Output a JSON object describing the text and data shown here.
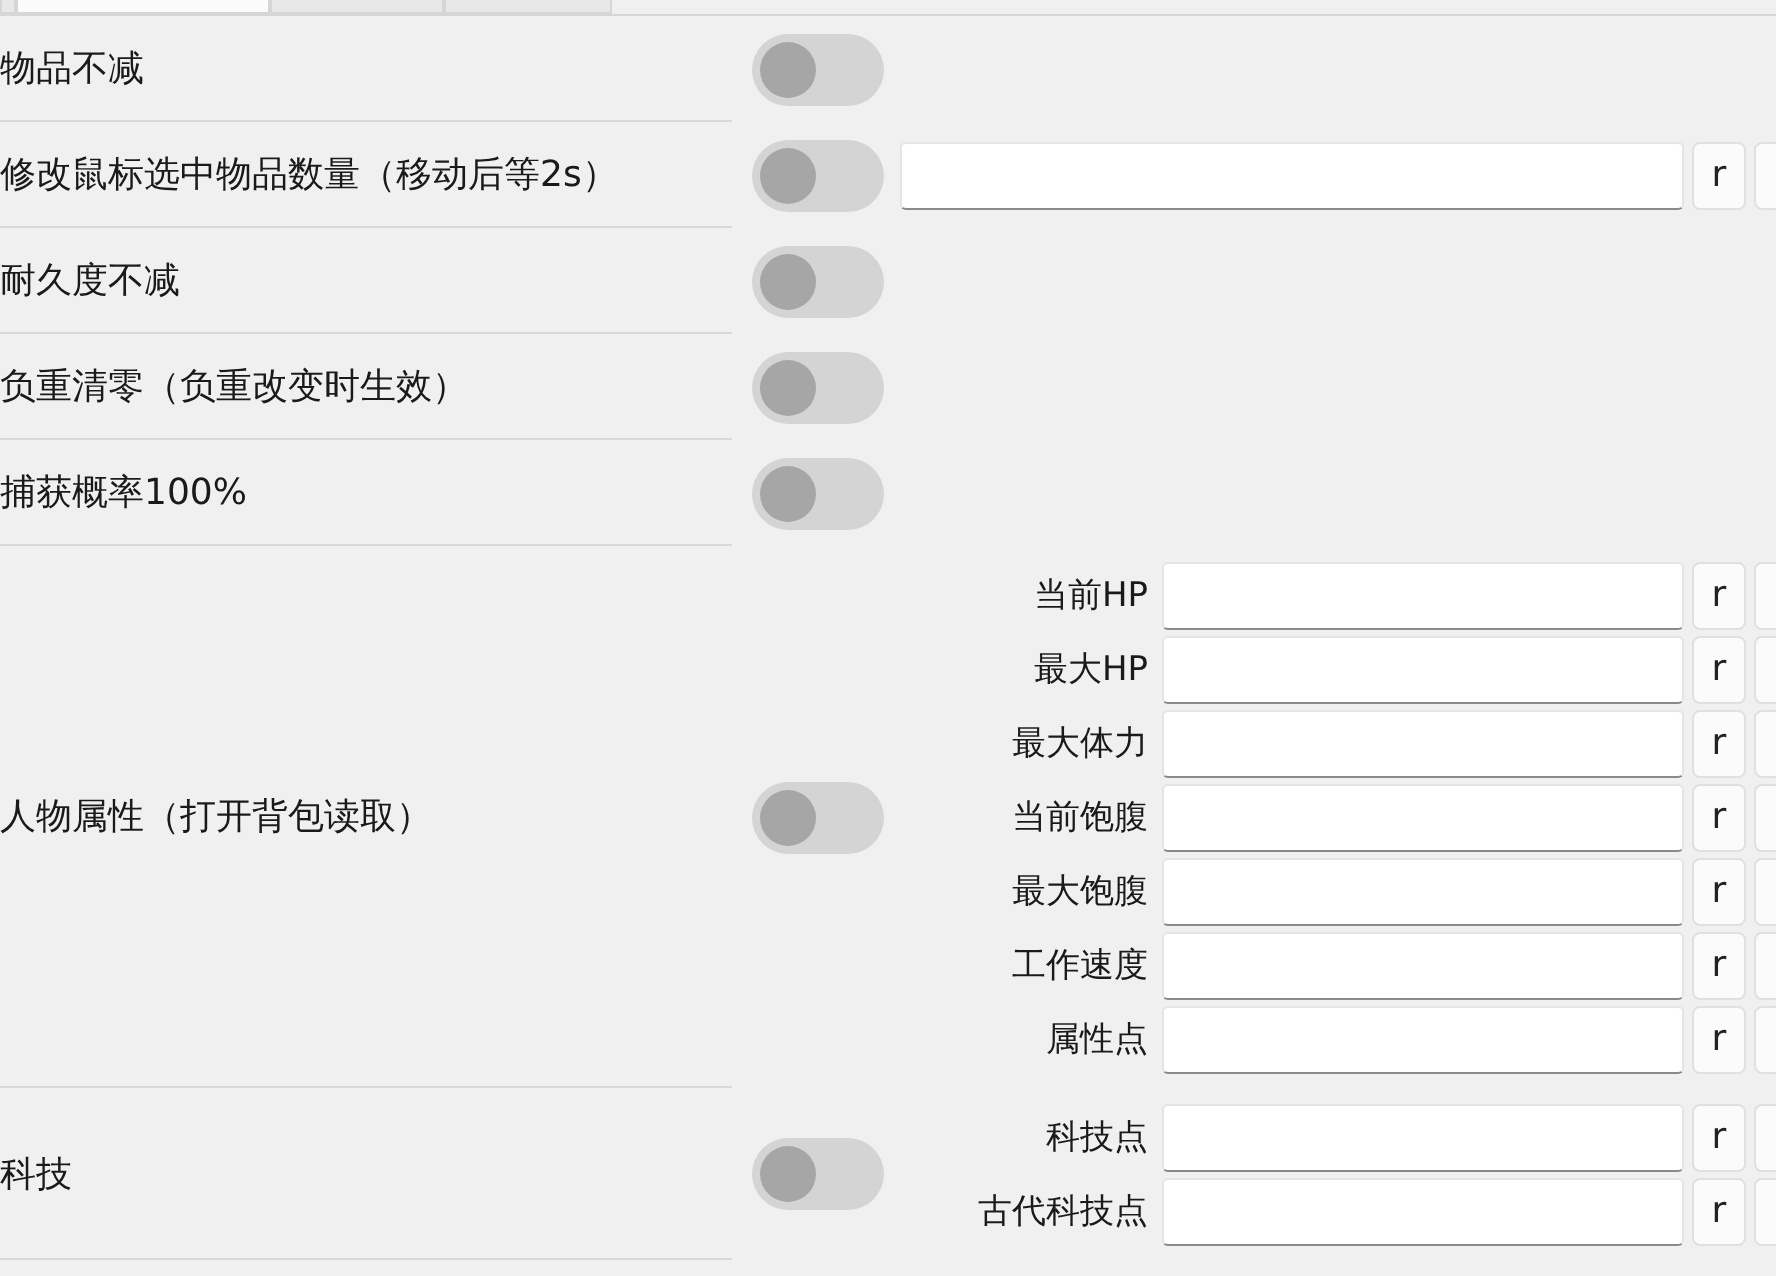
{
  "tabs": [
    {
      "selected": false
    },
    {
      "selected": true
    },
    {
      "selected": false
    },
    {
      "selected": false
    }
  ],
  "rows": [
    {
      "label": "物品不减",
      "on": false
    },
    {
      "label": "修改鼠标选中物品数量（移动后等2s）",
      "on": false,
      "fields": [
        {
          "button": "r"
        }
      ]
    },
    {
      "label": "耐久度不减",
      "on": false
    },
    {
      "label": "负重清零（负重改变时生效）",
      "on": false
    },
    {
      "label": "捕获概率100%",
      "on": false
    },
    {
      "label": "人物属性（打开背包读取）",
      "on": false,
      "fields": [
        {
          "label": "当前HP",
          "button": "r"
        },
        {
          "label": "最大HP",
          "button": "r"
        },
        {
          "label": "最大体力",
          "button": "r"
        },
        {
          "label": "当前饱腹",
          "button": "r"
        },
        {
          "label": "最大饱腹",
          "button": "r"
        },
        {
          "label": "工作速度",
          "button": "r"
        },
        {
          "label": "属性点",
          "button": "r"
        }
      ]
    },
    {
      "label": "科技",
      "on": false,
      "fields": [
        {
          "label": "科技点",
          "button": "r"
        },
        {
          "label": "古代科技点",
          "button": "r"
        }
      ]
    }
  ]
}
